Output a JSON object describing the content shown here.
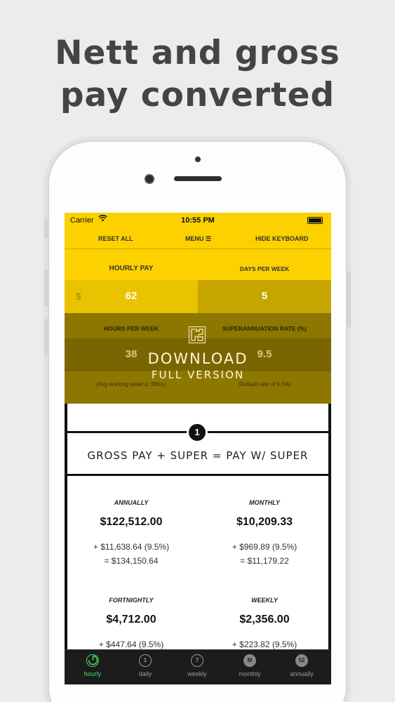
{
  "headline": {
    "line1": "Nett and gross",
    "line2": "pay converted"
  },
  "status": {
    "carrier": "Carrier",
    "time": "10:55 PM"
  },
  "toolbar": {
    "reset": "RESET ALL",
    "menu": "MENU ☰",
    "hide": "HIDE KEYBOARD"
  },
  "inputs": {
    "hourly_pay_label": "HOURLY PAY",
    "currency": "$",
    "hourly_pay_value": "62",
    "days_label": "DAYS PER WEEK",
    "days_value": "5",
    "hours_label": "HOURS PER WEEK",
    "hours_value": "38",
    "hours_hint": "(Avg working week is 38hrs)",
    "super_label": "SUPERANNUATION RATE (%)",
    "super_value": "9.5",
    "super_hint": "(Default rate of 9.5%)"
  },
  "download": {
    "title": "DOWNLOAD",
    "subtitle": "FULL VERSION"
  },
  "step": {
    "number": "1",
    "formula": "GROSS PAY + SUPER = PAY W/ SUPER"
  },
  "results": {
    "annually": {
      "label": "ANNUALLY",
      "value": "$122,512.00",
      "super": "+ $11,638.64 (9.5%)",
      "total": "= $134,150.64"
    },
    "monthly": {
      "label": "MONTHLY",
      "value": "$10,209.33",
      "super": "+ $969.89 (9.5%)",
      "total": "= $11,179.22"
    },
    "fortnightly": {
      "label": "FORTNIGHTLY",
      "value": "$4,712.00",
      "super": "+ $447.64 (9.5%)"
    },
    "weekly": {
      "label": "WEEKLY",
      "value": "$2,356.00",
      "super": "+ $223.82 (9.5%)"
    }
  },
  "tabs": [
    {
      "label": "hourly",
      "icon": ""
    },
    {
      "label": "daily",
      "icon": "1"
    },
    {
      "label": "weekly",
      "icon": "7"
    },
    {
      "label": "monthly",
      "icon": "M"
    },
    {
      "label": "annually",
      "icon": "52"
    }
  ],
  "colors": {
    "brand_yellow": "#fdd000",
    "active_tab": "#4cd964"
  }
}
